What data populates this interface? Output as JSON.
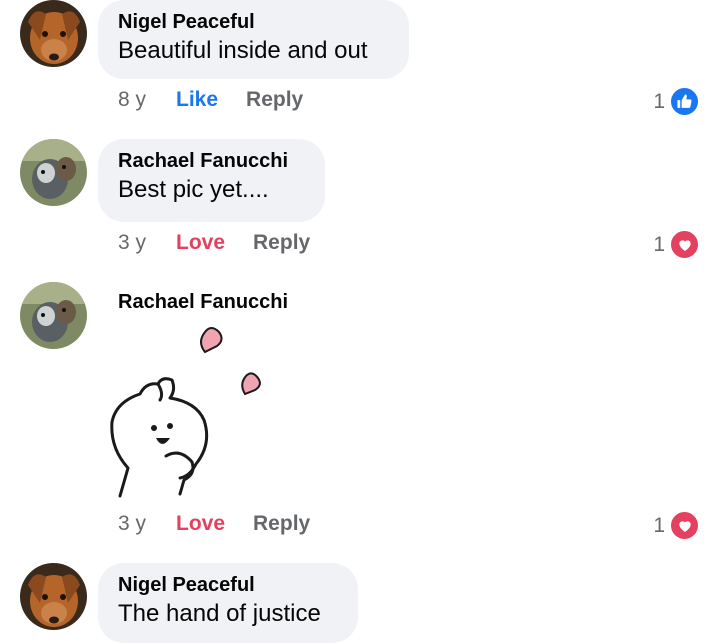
{
  "comments": [
    {
      "author": "Nigel Peaceful",
      "text": "Beautiful inside and out",
      "time": "8 y",
      "reaction_action": "Like",
      "reply_label": "Reply",
      "reaction_count": "1",
      "reaction_icon": "like-icon"
    },
    {
      "author": "Rachael Fanucchi",
      "text": "Best pic yet....",
      "time": "3 y",
      "reaction_action": "Love",
      "reply_label": "Reply",
      "reaction_count": "1",
      "reaction_icon": "love-icon"
    },
    {
      "author": "Rachael Fanucchi",
      "sticker": "bunny-hearts-sticker",
      "time": "3 y",
      "reaction_action": "Love",
      "reply_label": "Reply",
      "reaction_count": "1",
      "reaction_icon": "love-icon"
    },
    {
      "author": "Nigel Peaceful",
      "text": "The hand of justice"
    }
  ],
  "colors": {
    "like_blue": "#1877f2",
    "love_red": "#e4405f",
    "bubble_bg": "#f0f2f5",
    "meta_gray": "#65676b"
  }
}
